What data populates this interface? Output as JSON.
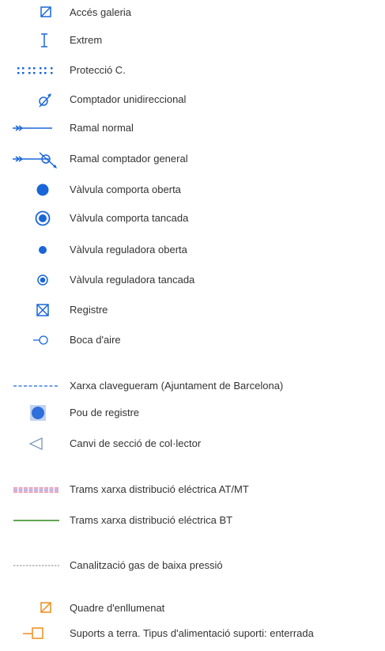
{
  "legend": {
    "items": [
      {
        "label": "Accés galeria",
        "icon": "square-slash-icon",
        "color": "#1a66d9"
      },
      {
        "label": "Extrem",
        "icon": "i-beam-icon",
        "color": "#1a66d9"
      },
      {
        "label": "Protecció C.",
        "icon": "dotted-grid-icon",
        "color": "#1a66d9"
      },
      {
        "label": "Comptador unidireccional",
        "icon": "meter-arrow-icon",
        "color": "#1a66d9"
      },
      {
        "label": "Ramal normal",
        "icon": "branch-line-icon",
        "color": "#1a66d9"
      },
      {
        "label": "Ramal comptador general",
        "icon": "branch-meter-icon",
        "color": "#1a66d9"
      },
      {
        "label": "Vàlvula comporta oberta",
        "icon": "filled-circle-icon",
        "color": "#1a66d9"
      },
      {
        "label": "Vàlvula comporta tancada",
        "icon": "ringed-circle-icon",
        "color": "#1a66d9"
      },
      {
        "label": "Vàlvula reguladora oberta",
        "icon": "small-filled-circle-icon",
        "color": "#1a66d9"
      },
      {
        "label": "Vàlvula reguladora tancada",
        "icon": "small-ringed-circle-icon",
        "color": "#1a66d9"
      },
      {
        "label": "Registre",
        "icon": "square-x-icon",
        "color": "#1a66d9"
      },
      {
        "label": "Boca d'aire",
        "icon": "line-circle-icon",
        "color": "#1a66d9"
      },
      {
        "label": "Xarxa clavegueram (Ajuntament de Barcelona)",
        "icon": "dashed-line-icon",
        "color": "#1a66d9"
      },
      {
        "label": "Pou de registre",
        "icon": "square-circle-icon",
        "color": "#1a66d9"
      },
      {
        "label": "Canvi de secció de col·lector",
        "icon": "triangle-left-icon",
        "color": "#6f8fb3"
      },
      {
        "label": "Trams xarxa distribució eléctrica AT/MT",
        "icon": "hatched-line-icon",
        "color": "#d9608f"
      },
      {
        "label": "Trams xarxa distribució eléctrica BT",
        "icon": "solid-line-icon",
        "color": "#4a9a3a"
      },
      {
        "label": "Canalització gas de baixa pressió",
        "icon": "dashed-line-icon",
        "color": "#888888"
      },
      {
        "label": "Quadre d'enllumenat",
        "icon": "square-slash-icon",
        "color": "#f08c1a"
      },
      {
        "label": "Suports a terra. Tipus d'alimentació suporti: enterrada",
        "icon": "line-square-icon",
        "color": "#f08c1a"
      }
    ]
  }
}
